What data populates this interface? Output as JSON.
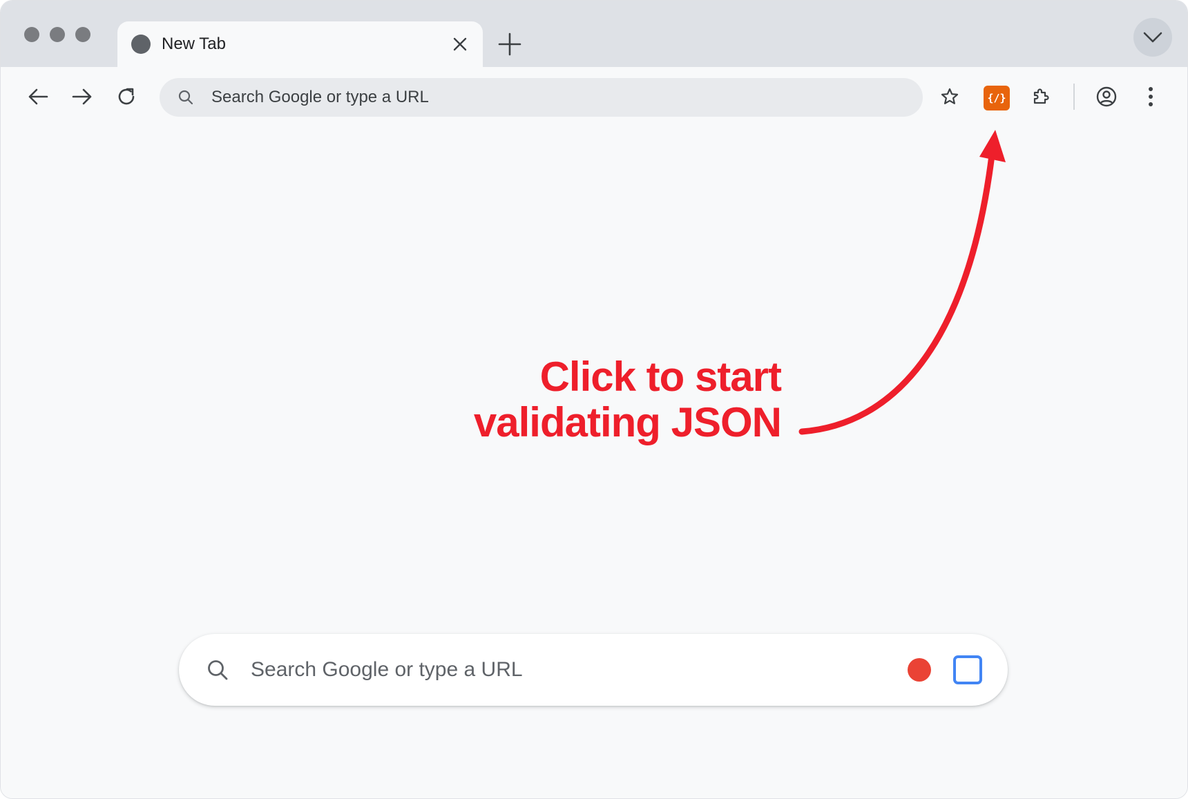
{
  "browser": {
    "tab": {
      "title": "New Tab"
    },
    "omnibox": {
      "text": "Search Google or type a URL"
    },
    "extension": {
      "label": "{/}",
      "color": "#e8640c"
    },
    "icons": {
      "back": "arrow-left-icon",
      "forward": "arrow-right-icon",
      "reload": "reload-icon",
      "bookmark": "star-icon",
      "extensions": "puzzle-icon",
      "profile": "account-circle-icon",
      "menu": "more-vertical-icon"
    }
  },
  "annotation": {
    "line1": "Click to start",
    "line2": "validating JSON",
    "color": "#ee1f2b"
  },
  "ntp": {
    "search": {
      "placeholder": "Search Google or type a URL"
    },
    "voice_color": "#ea4335",
    "lens_color": "#4285f4"
  }
}
